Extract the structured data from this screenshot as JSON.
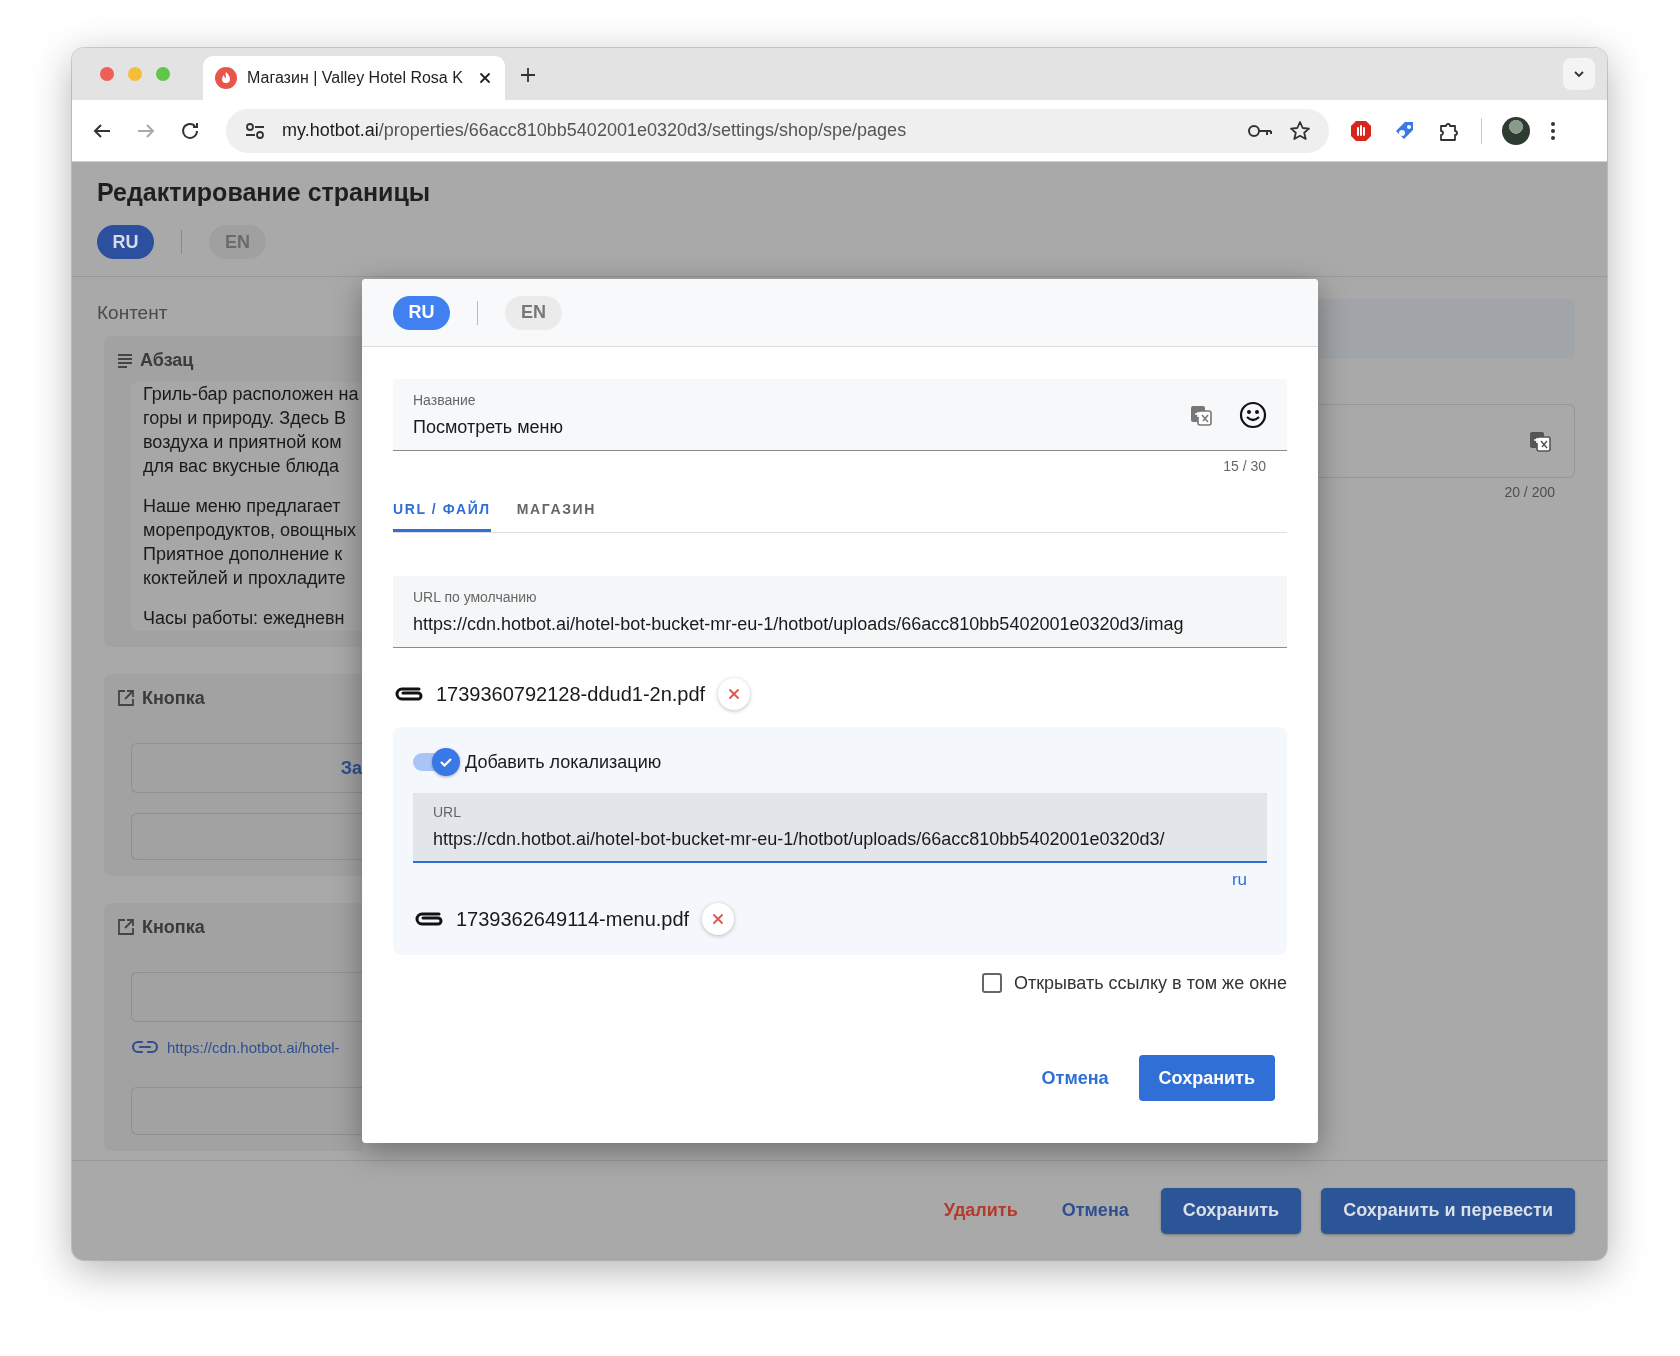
{
  "browser": {
    "tab_title": "Магазин | Valley Hotel Rosa K",
    "url_host": "my.hotbot.ai",
    "url_path": "/properties/66acc810bb5402001e0320d3/settings/shop/spe/pages"
  },
  "page": {
    "title": "Редактирование страницы",
    "languages": [
      {
        "label": "RU",
        "selected": true
      },
      {
        "label": "EN",
        "selected": false
      }
    ],
    "section_label": "Контент",
    "blocks": [
      {
        "kind": "paragraph",
        "title": "Абзац",
        "paragraphs": [
          [
            "Гриль-бар расположен на",
            "горы и природу. Здесь В",
            "воздуха и приятной ком",
            "для вас вкусные блюда"
          ],
          [
            "Наше меню предлагает",
            "морепродуктов, овощных",
            "Приятное дополнение к",
            "коктейлей и прохладите"
          ],
          [
            "Часы работы: ежедневн"
          ]
        ]
      },
      {
        "kind": "button",
        "title": "Кнопка",
        "button_text": "За"
      },
      {
        "kind": "button",
        "title": "Кнопка",
        "link": "https://cdn.hotbot.ai/hotel-"
      }
    ],
    "side_counter": "20 / 200",
    "actions": [
      {
        "kind": "danger",
        "label": "Удалить"
      },
      {
        "kind": "text",
        "label": "Отмена"
      },
      {
        "kind": "primary",
        "label": "Сохранить"
      },
      {
        "kind": "primary",
        "label": "Сохранить и перевести"
      }
    ]
  },
  "modal": {
    "languages": [
      {
        "label": "RU",
        "selected": true
      },
      {
        "label": "EN",
        "selected": false
      }
    ],
    "name_field": {
      "label": "Название",
      "value": "Посмотреть меню",
      "counter": "15 / 30"
    },
    "tabs": [
      {
        "label": "URL / ФАЙЛ",
        "selected": true
      },
      {
        "label": "МАГАЗИН",
        "selected": false
      }
    ],
    "default_url": {
      "label": "URL по умолчанию",
      "value": "https://cdn.hotbot.ai/hotel-bot-bucket-mr-eu-1/hotbot/uploads/66acc810bb5402001e0320d3/imag"
    },
    "file": "1739360792128-ddud1-2n.pdf",
    "localization": {
      "label": "Добавить локализацию",
      "on": true,
      "url_label": "URL",
      "url_value": "https://cdn.hotbot.ai/hotel-bot-bucket-mr-eu-1/hotbot/uploads/66acc810bb5402001e0320d3/",
      "locale": "ru",
      "file": "1739362649114-menu.pdf"
    },
    "same_window": {
      "label": "Открывать ссылку в том же окне",
      "checked": false
    },
    "buttons": [
      {
        "kind": "text",
        "label": "Отмена"
      },
      {
        "kind": "primary",
        "label": "Сохранить"
      }
    ]
  }
}
